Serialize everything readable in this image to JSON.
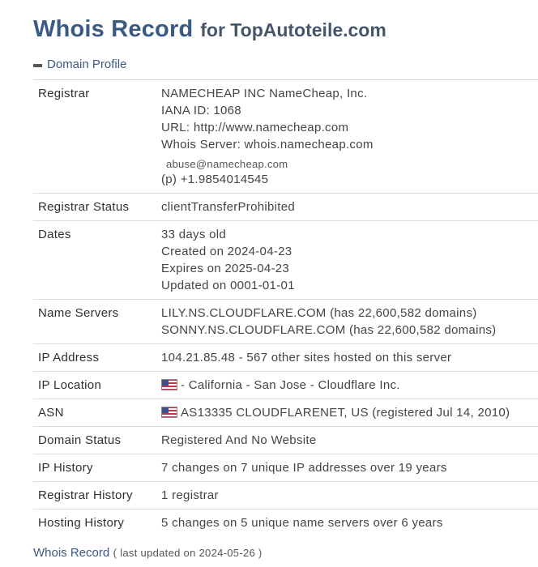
{
  "header": {
    "title": "Whois Record",
    "subtitle": "for TopAutoteile.com"
  },
  "section": {
    "label": "Domain Profile",
    "icon": "minus-icon"
  },
  "rows": {
    "registrar": {
      "label": "Registrar",
      "name": "NAMECHEAP INC NameCheap, Inc.",
      "iana": "IANA ID: 1068",
      "url": "URL: http://www.namecheap.com",
      "whois_server": "Whois Server: whois.namecheap.com",
      "email": "abuse@namecheap.com",
      "phone": "(p)  +1.9854014545"
    },
    "registrar_status": {
      "label": "Registrar Status",
      "value": "clientTransferProhibited"
    },
    "dates": {
      "label": "Dates",
      "age": "33 days old",
      "created": "Created on 2024-04-23",
      "expires": "Expires on 2025-04-23",
      "updated": "Updated on 0001-01-01"
    },
    "name_servers": {
      "label": "Name Servers",
      "ns1": "LILY.NS.CLOUDFLARE.COM (has 22,600,582 domains)",
      "ns2": "SONNY.NS.CLOUDFLARE.COM (has 22,600,582 domains)"
    },
    "ip_address": {
      "label": "IP Address",
      "value": "104.21.85.48 - 567 other sites hosted on this server"
    },
    "ip_location": {
      "label": "IP Location",
      "flag": "us-flag-icon",
      "value": "- California - San Jose - Cloudflare Inc."
    },
    "asn": {
      "label": "ASN",
      "flag": "us-flag-icon",
      "value": "AS13335 CLOUDFLARENET, US (registered Jul 14, 2010)"
    },
    "domain_status": {
      "label": "Domain Status",
      "value": "Registered And No Website"
    },
    "ip_history": {
      "label": "IP History",
      "value": "7 changes on 7 unique IP addresses over 19 years"
    },
    "registrar_history": {
      "label": "Registrar History",
      "value": "1 registrar"
    },
    "hosting_history": {
      "label": "Hosting History",
      "value": "5 changes on 5 unique name servers over 6 years"
    }
  },
  "footer": {
    "link": "Whois Record",
    "note": "( last updated on 2024-05-26 )"
  },
  "colors": {
    "title": "#3a5a82",
    "link": "#3a5a82",
    "text": "#444444",
    "divider": "#dcdcdc"
  }
}
